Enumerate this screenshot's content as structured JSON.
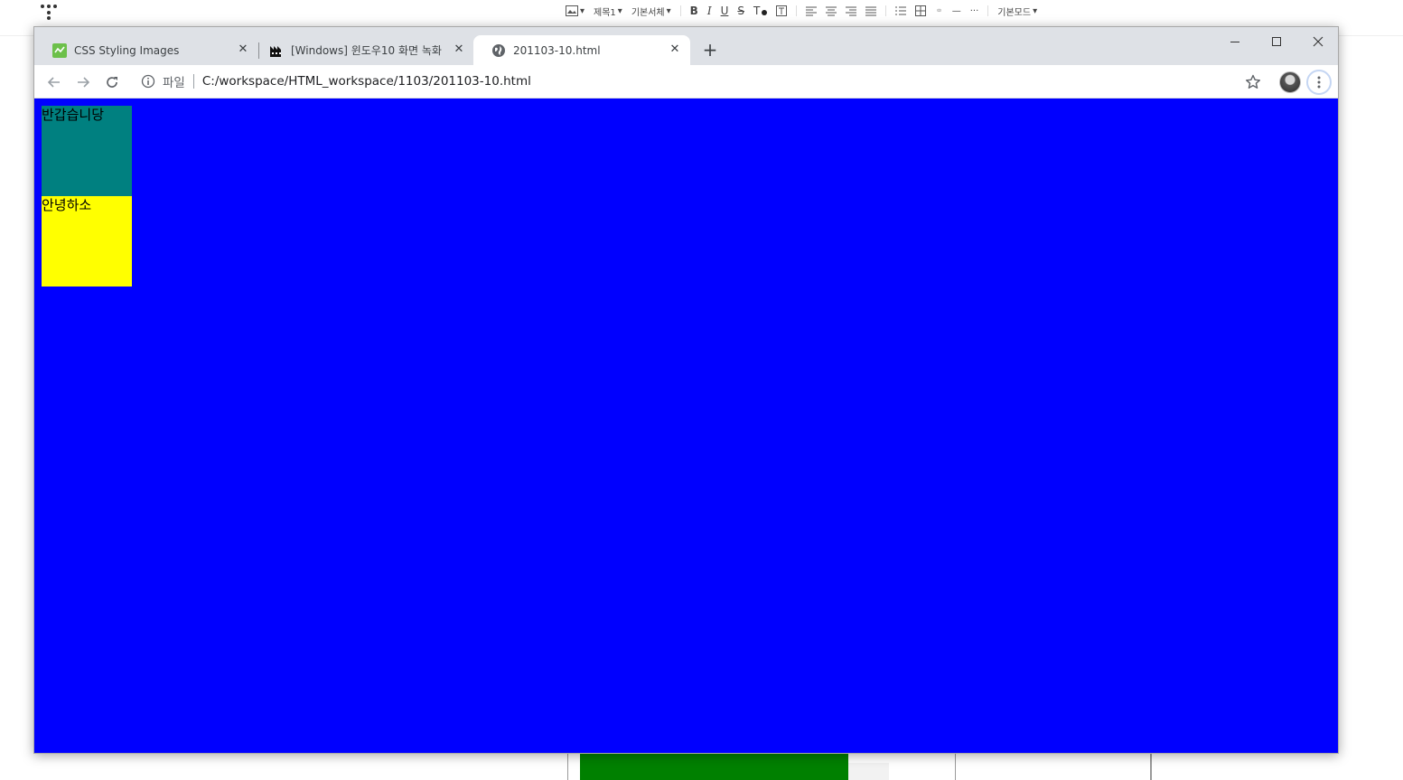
{
  "editor_toolbar": {
    "heading_label": "제목1",
    "font_label": "기본서체",
    "text_color_label": "T",
    "mode_label": "기본모드"
  },
  "browser": {
    "tabs": [
      {
        "title": "CSS Styling Images",
        "favicon": "codepen-green-icon",
        "active": false
      },
      {
        "title": "[Windows] 윈도우10 화면 녹화",
        "favicon": "tistory-chart-icon",
        "active": false
      },
      {
        "title": "201103-10.html",
        "favicon": "globe-icon",
        "active": true
      }
    ],
    "address_bar": {
      "scheme_label": "파일",
      "url": "C:/workspace/HTML_workspace/1103/201103-10.html"
    },
    "colors": {
      "tabstrip": "#dee1e6",
      "toolbar": "#ffffff"
    }
  },
  "page": {
    "background": "#0000ff",
    "boxes": [
      {
        "text": "반갑습니당",
        "color": "#008080"
      },
      {
        "text": "안녕하소",
        "color": "#ffff00"
      }
    ]
  }
}
